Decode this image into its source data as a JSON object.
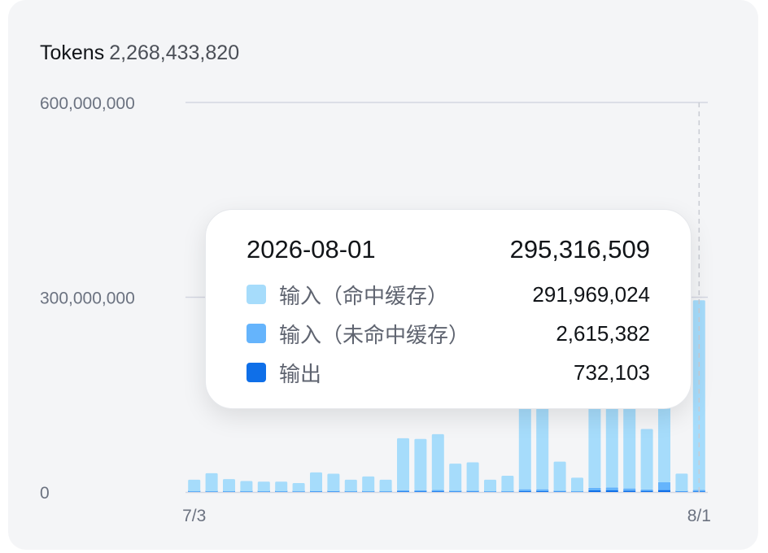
{
  "header": {
    "label": "Tokens",
    "total": "2,268,433,820"
  },
  "colors": {
    "cache_hit": "#a6dcfb",
    "cache_miss": "#65b4fc",
    "output": "#0f6fe8",
    "grid": "#d4d7e2"
  },
  "chart_data": {
    "type": "bar",
    "stacked": true,
    "ylim": [
      0,
      600000000
    ],
    "yticks": [
      {
        "value": 0,
        "label": "0"
      },
      {
        "value": 300000000,
        "label": "300,000,000"
      },
      {
        "value": 600000000,
        "label": "600,000,000"
      }
    ],
    "x_tick_labels": [
      {
        "index": 0,
        "label": "7/3"
      },
      {
        "index": 29,
        "label": "8/1"
      }
    ],
    "series": [
      {
        "key": "cache_hit",
        "name": "输入（命中缓存）",
        "values": [
          18000000,
          28000000,
          19000000,
          16000000,
          15000000,
          15000000,
          13000000,
          29000000,
          27000000,
          18000000,
          23000000,
          18000000,
          80000000,
          79000000,
          86000000,
          42000000,
          44000000,
          18000000,
          24000000,
          160000000,
          155000000,
          45000000,
          21000000,
          168000000,
          185000000,
          142000000,
          93000000,
          250000000,
          27000000,
          291969024
        ]
      },
      {
        "key": "cache_miss",
        "name": "输入（未命中缓存）",
        "values": [
          600000,
          700000,
          600000,
          600000,
          600000,
          600000,
          500000,
          800000,
          800000,
          600000,
          700000,
          600000,
          2000000,
          2000000,
          2200000,
          1200000,
          1200000,
          600000,
          700000,
          3000000,
          3000000,
          1300000,
          700000,
          4000000,
          4500000,
          3500000,
          2500000,
          12000000,
          900000,
          2615382
        ]
      },
      {
        "key": "output",
        "name": "输出",
        "values": [
          300000,
          300000,
          300000,
          300000,
          300000,
          300000,
          300000,
          400000,
          400000,
          300000,
          300000,
          300000,
          800000,
          800000,
          900000,
          500000,
          500000,
          300000,
          300000,
          1200000,
          1200000,
          500000,
          300000,
          2500000,
          2500000,
          2000000,
          1500000,
          3000000,
          400000,
          732103
        ]
      }
    ]
  },
  "tooltip": {
    "date": "2026-08-01",
    "total": "295,316,509",
    "rows": [
      {
        "name": "输入（命中缓存）",
        "value": "291,969,024"
      },
      {
        "name": "输入（未命中缓存）",
        "value": "2,615,382"
      },
      {
        "name": "输出",
        "value": "732,103"
      }
    ]
  }
}
